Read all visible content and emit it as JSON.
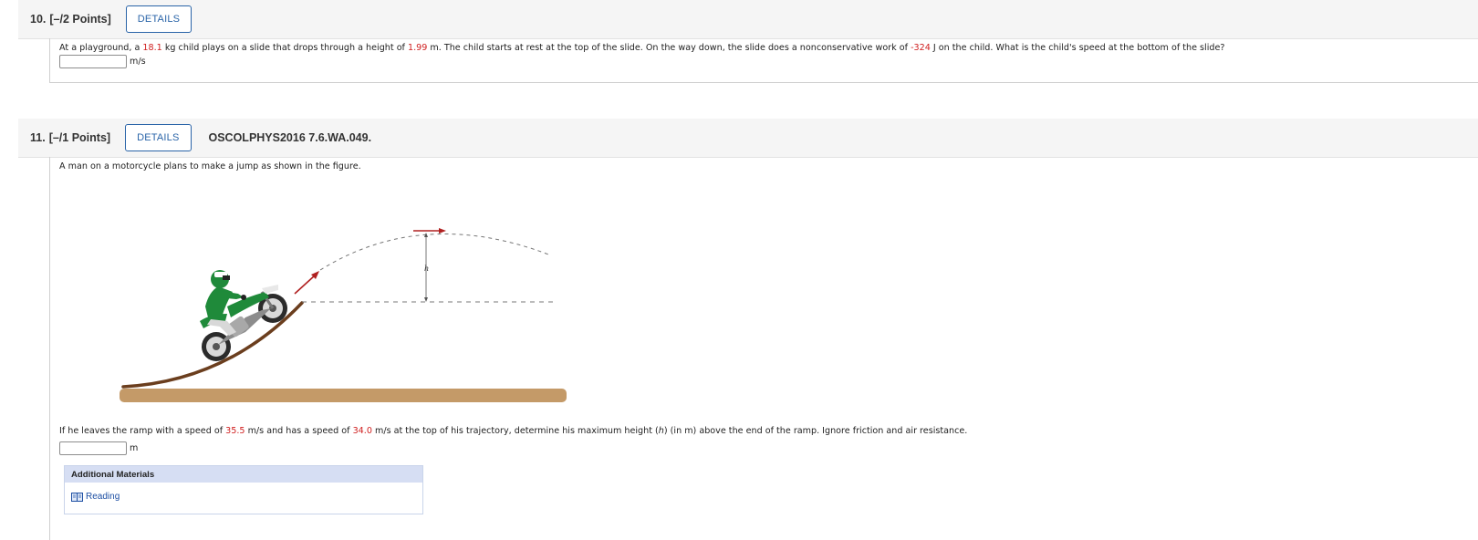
{
  "q10": {
    "number": "10.",
    "points": "[–/2 Points]",
    "details_label": "DETAILS",
    "prompt_parts": [
      "At a playground, a ",
      "18.1",
      " kg child plays on a slide that drops through a height of ",
      "1.99",
      " m. The child starts at rest at the top of the slide. On the way down, the slide does a nonconservative work of ",
      "-324",
      " J on the child. What is the child's speed at the bottom of the slide?"
    ],
    "answer_value": "",
    "unit": "m/s"
  },
  "q11": {
    "number": "11.",
    "points": "[–/1 Points]",
    "details_label": "DETAILS",
    "code": "OSCOLPHYS2016 7.6.WA.049.",
    "intro": "A man on a motorcycle plans to make a jump as shown in the figure.",
    "figure_label": "h",
    "prompt_parts": [
      "If he leaves the ramp with a speed of ",
      "35.5",
      " m/s and has a speed of ",
      "34.0",
      " m/s at the top of his trajectory, determine his maximum height (",
      "h",
      ") (in m) above the end of the ramp. Ignore friction and air resistance."
    ],
    "answer_value": "",
    "unit": "m",
    "additional_materials": {
      "title": "Additional Materials",
      "link_label": "Reading"
    }
  },
  "colors": {
    "highlight_red": "#d02020",
    "link_blue": "#1d4fa3",
    "ramp_brown": "#6b3e1e",
    "ground_tan": "#c49a68",
    "rider_green": "#1f8a3a",
    "vector_red": "#b02020"
  }
}
